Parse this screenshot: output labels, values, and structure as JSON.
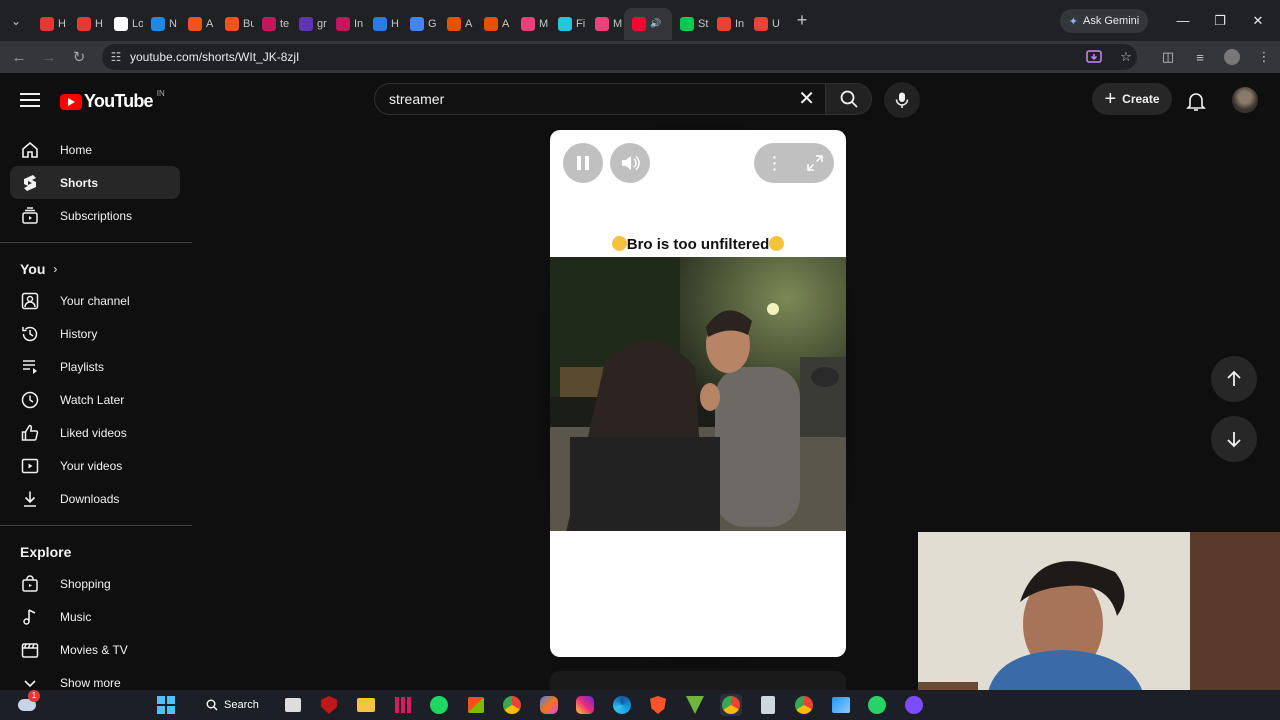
{
  "browser": {
    "tabs": [
      {
        "title": "H",
        "favicon_color": "#e53935"
      },
      {
        "title": "H",
        "favicon_color": "#e53935"
      },
      {
        "title": "Lo",
        "favicon_color": "#ffffff"
      },
      {
        "title": "N",
        "favicon_color": "#1e88e5"
      },
      {
        "title": "A",
        "favicon_color": "#f4511e"
      },
      {
        "title": "Bu",
        "favicon_color": "#f4511e"
      },
      {
        "title": "te",
        "favicon_color": "#c2185b"
      },
      {
        "title": "gr",
        "favicon_color": "#5e35b1"
      },
      {
        "title": "In",
        "favicon_color": "#c2185b"
      },
      {
        "title": "H",
        "favicon_color": "#2c7be5"
      },
      {
        "title": "G",
        "favicon_color": "#4285f4"
      },
      {
        "title": "A",
        "favicon_color": "#e65100"
      },
      {
        "title": "A",
        "favicon_color": "#e65100"
      },
      {
        "title": "M",
        "favicon_color": "#ec407a"
      },
      {
        "title": "Fi",
        "favicon_color": "#26c6da"
      },
      {
        "title": "M",
        "favicon_color": "#ec407a"
      },
      {
        "title": "",
        "favicon_color": "#ff0033"
      },
      {
        "title": "St",
        "favicon_color": "#00c853"
      },
      {
        "title": "In",
        "favicon_color": "#ea4335"
      },
      {
        "title": "U",
        "favicon_color": "#ea4335"
      }
    ],
    "active_tab_index": 16,
    "new_tab_label": "+",
    "gemini_label": "Ask Gemini",
    "url": "youtube.com/shorts/WIt_JK-8zjI"
  },
  "masthead": {
    "logo_text": "YouTube",
    "region": "IN",
    "search_value": "streamer",
    "search_placeholder": "Search",
    "create_label": "Create"
  },
  "sidebar": {
    "main": [
      {
        "label": "Home",
        "icon": "home-icon"
      },
      {
        "label": "Shorts",
        "icon": "shorts-icon",
        "active": true
      },
      {
        "label": "Subscriptions",
        "icon": "subscriptions-icon"
      }
    ],
    "you_heading": "You",
    "you": [
      {
        "label": "Your channel",
        "icon": "channel-icon"
      },
      {
        "label": "History",
        "icon": "history-icon"
      },
      {
        "label": "Playlists",
        "icon": "playlists-icon"
      },
      {
        "label": "Watch Later",
        "icon": "watch-later-icon"
      },
      {
        "label": "Liked videos",
        "icon": "like-icon"
      },
      {
        "label": "Your videos",
        "icon": "your-videos-icon"
      },
      {
        "label": "Downloads",
        "icon": "download-icon"
      }
    ],
    "explore_heading": "Explore",
    "explore": [
      {
        "label": "Shopping",
        "icon": "shopping-icon"
      },
      {
        "label": "Music",
        "icon": "music-icon"
      },
      {
        "label": "Movies & TV",
        "icon": "movies-icon"
      },
      {
        "label": "Show more",
        "icon": "show-more-icon"
      }
    ]
  },
  "short": {
    "caption": "Bro is too unfiltered",
    "caption_emoji": "face-with-tears-of-joy"
  },
  "taskbar": {
    "search_label": "Search",
    "notification_count": "1"
  },
  "colors": {
    "page_bg": "#0f0f0f",
    "brand_red": "#ff0000",
    "active_item_bg": "#272727"
  }
}
